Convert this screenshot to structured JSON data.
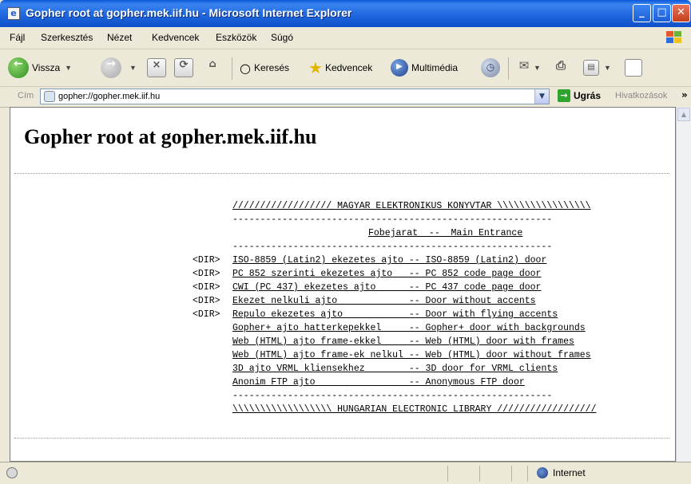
{
  "window": {
    "title": "Gopher root at gopher.mek.iif.hu - Microsoft Internet Explorer",
    "icon": "ie-page-icon",
    "controls": [
      "minimize",
      "maximize",
      "close"
    ]
  },
  "menu": {
    "items": [
      "Fájl",
      "Szerkesztés",
      "Nézet",
      "Kedvencek",
      "Eszközök",
      "Súgó"
    ]
  },
  "toolbar": {
    "back": "Vissza",
    "search": "Keresés",
    "favorites": "Kedvencek",
    "media": "Multimédia"
  },
  "address": {
    "label": "Cím",
    "value": "gopher://gopher.mek.iif.hu",
    "go": "Ugrás",
    "links": "Hivatkozások"
  },
  "page": {
    "title": "Gopher root at gopher.mek.iif.hu",
    "header_top": "////////////////// MAGYAR ELEKTRONIKUS KONYVTAR \\\\\\\\\\\\\\\\\\\\\\\\\\\\\\\\\\",
    "rule": "----------------------------------------------------------",
    "entrance": "Fobejarat  --  Main Entrance",
    "footer_bottom": "\\\\\\\\\\\\\\\\\\\\\\\\\\\\\\\\\\\\ HUNGARIAN ELECTRONIC LIBRARY //////////////////",
    "items": [
      {
        "type": "<DIR>",
        "text": "ISO-8859 (Latin2) ekezetes ajto -- ISO-8859 (Latin2) door"
      },
      {
        "type": "<DIR>",
        "text": "PC 852 szerinti ekezetes ajto   -- PC 852 code page door"
      },
      {
        "type": "<DIR>",
        "text": "CWI (PC 437) ekezetes ajto      -- PC 437 code page door"
      },
      {
        "type": "<DIR>",
        "text": "Ekezet nelkuli ajto             -- Door without accents"
      },
      {
        "type": "<DIR>",
        "text": "Repulo ekezetes ajto            -- Door with flying accents"
      },
      {
        "type": "",
        "text": "Gopher+ ajto hatterkepekkel     -- Gopher+ door with backgrounds"
      },
      {
        "type": "",
        "text": "Web (HTML) ajto frame-ekkel     -- Web (HTML) door with frames"
      },
      {
        "type": "",
        "text": "Web (HTML) ajto frame-ek nelkul -- Web (HTML) door without frames"
      },
      {
        "type": "",
        "text": "3D ajto VRML kliensekhez        -- 3D door for VRML clients"
      },
      {
        "type": "",
        "text": "Anonim FTP ajto                 -- Anonymous FTP door"
      }
    ]
  },
  "status": {
    "zone": "Internet"
  }
}
